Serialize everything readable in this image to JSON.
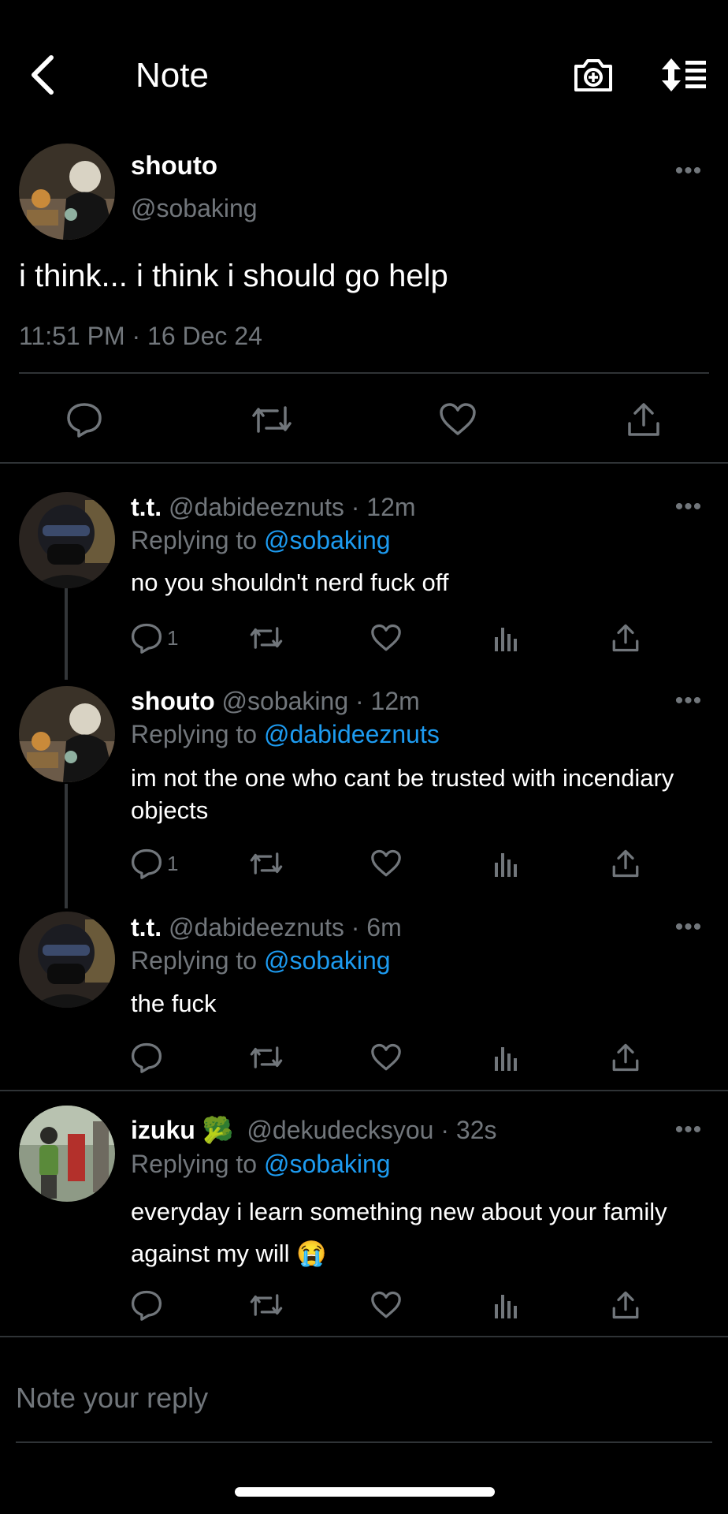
{
  "header": {
    "title": "Note",
    "back_icon": "chevron-left-icon",
    "camera_icon": "camera-plus-icon",
    "sort_icon": "sort-list-icon"
  },
  "main_post": {
    "author_name": "shouto",
    "author_handle": "@sobaking",
    "text": "i think... i think i should go help",
    "timestamp": "11:51 PM · 16 Dec 24"
  },
  "replies": [
    {
      "name": "t.t.",
      "handle": "@dabideeznuts",
      "time": "· 12m",
      "replying_label": "Replying to",
      "replying_to": "@sobaking",
      "text": "no you shouldn't nerd fuck off",
      "reply_count": "1"
    },
    {
      "name": "shouto",
      "handle": "@sobaking",
      "time": "· 12m",
      "replying_label": "Replying to",
      "replying_to": "@dabideeznuts",
      "text": "im not the one who cant be trusted with incendiary objects",
      "reply_count": "1"
    },
    {
      "name": "t.t.",
      "handle": "@dabideeznuts",
      "time": "· 6m",
      "replying_label": "Replying to",
      "replying_to": "@sobaking",
      "text": "the fuck",
      "reply_count": ""
    },
    {
      "name": "izuku",
      "name_emoji": "🥦",
      "handle": "@dekudecksyou",
      "time": "· 32s",
      "replying_label": "Replying to",
      "replying_to": "@sobaking",
      "text": "everyday i learn something new about your family against my will 😭",
      "reply_count": ""
    }
  ],
  "composer": {
    "placeholder": "Note your reply"
  },
  "more_label": "•••",
  "colors": {
    "background": "#000000",
    "text": "#ffffff",
    "secondary": "#71767b",
    "accent": "#1d9bf0",
    "divider": "#2f3336"
  }
}
